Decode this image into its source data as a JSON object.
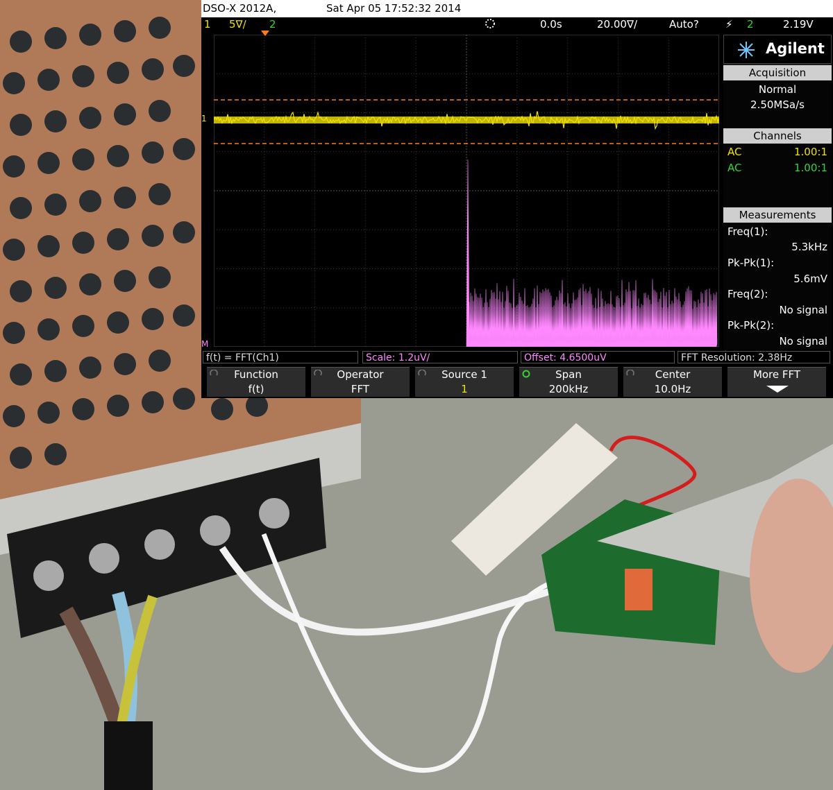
{
  "scope": {
    "model": "DSO-X 2012A,",
    "datetime": "Sat Apr 05 17:52:32 2014",
    "status": {
      "ch1_label": "1",
      "ch1_scale": "5∇/",
      "ch2_label": "2",
      "delay": "0.0s",
      "timebase": "20.00∇/",
      "trigger_mode": "Auto?",
      "trigger_ch": "2",
      "trigger_level": "2.19V"
    },
    "brand": "Agilent",
    "acquisition": {
      "title": "Acquisition",
      "mode": "Normal",
      "rate": "2.50MSa/s"
    },
    "channels": {
      "title": "Channels",
      "rows": [
        {
          "coupling": "AC",
          "probe": "1.00:1",
          "color": "#f2e200"
        },
        {
          "coupling": "AC",
          "probe": "1.00:1",
          "color": "#35d435"
        }
      ]
    },
    "measurements": {
      "title": "Measurements",
      "items": [
        {
          "label": "Freq(1):",
          "value": "5.3kHz"
        },
        {
          "label": "Pk-Pk(1):",
          "value": "5.6mV"
        },
        {
          "label": "Freq(2):",
          "value": "No signal"
        },
        {
          "label": "Pk-Pk(2):",
          "value": "No signal"
        }
      ]
    },
    "function_line": {
      "fn": "f(t) = FFT(Ch1)",
      "scale": "Scale: 1.2uV/",
      "offset": "Offset: 4.6500uV",
      "resolution": "FFT Resolution: 2.38Hz"
    },
    "softkeys": [
      {
        "label": "Function",
        "value": "f(t)"
      },
      {
        "label": "Operator",
        "value": "FFT"
      },
      {
        "label": "Source 1",
        "value": "1"
      },
      {
        "label": "Span",
        "value": "200kHz"
      },
      {
        "label": "Center",
        "value": "10.0Hz"
      },
      {
        "label": "More FFT",
        "value": ""
      }
    ],
    "colors": {
      "ch1": "#f2e200",
      "math": "#ff88ff",
      "cursor": "#ff7a1a",
      "accent_blue": "#6ec6ff"
    },
    "grid_label_ch1": "1",
    "grid_label_math": "M"
  }
}
